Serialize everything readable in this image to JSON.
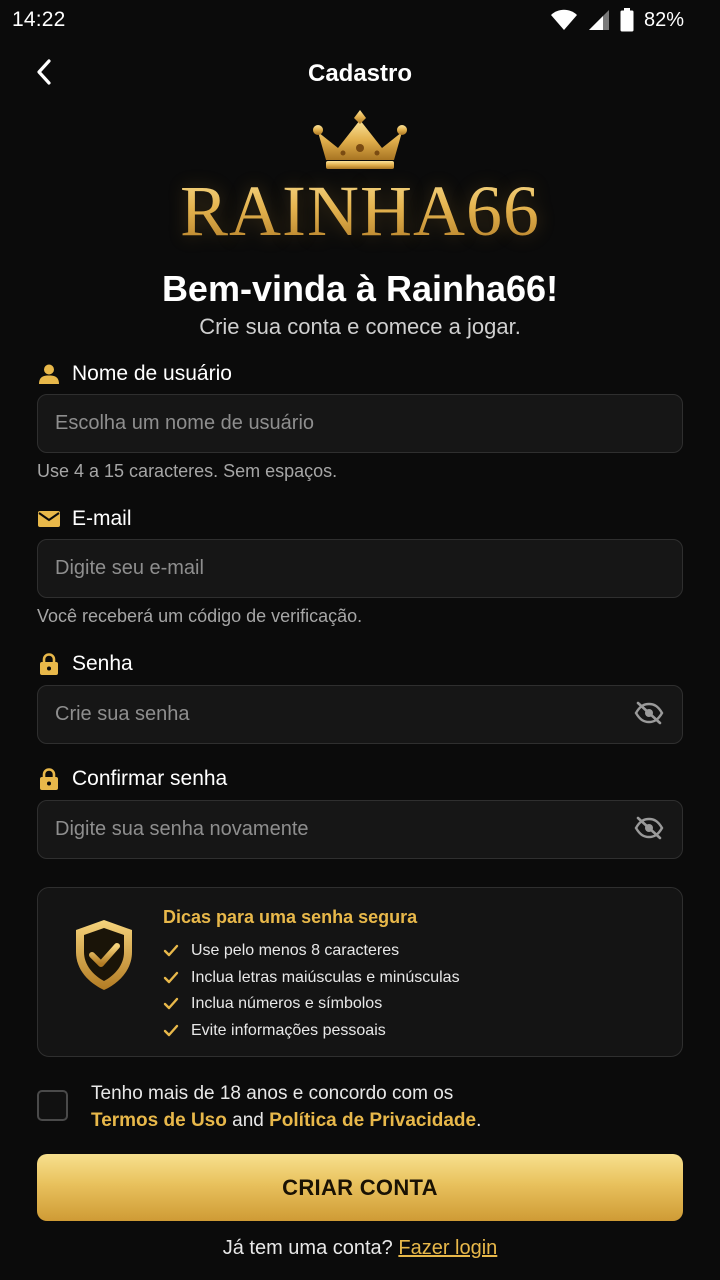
{
  "status_bar": {
    "time": "14:22",
    "battery_pct": "82%",
    "icons": [
      "wifi-icon",
      "signal-icon",
      "battery-icon"
    ]
  },
  "header": {
    "title": "Cadastro",
    "back_icon": "chevron-left-icon"
  },
  "logo": {
    "text": "RAINHA66",
    "icon": "crown-icon"
  },
  "welcome": {
    "title": "Bem-vinda à Rainha66!",
    "subtitle": "Crie sua conta e comece a jogar."
  },
  "form": {
    "username": {
      "label": "Nome de usuário",
      "icon": "user-icon",
      "placeholder": "Escolha um nome de usuário",
      "helper": "Use 4 a 15 caracteres. Sem espaços."
    },
    "email": {
      "label": "E-mail",
      "icon": "mail-icon",
      "placeholder": "Digite seu e-mail",
      "helper": "Você receberá um código de verificação."
    },
    "password": {
      "label": "Senha",
      "icon": "lock-icon",
      "placeholder": "Crie sua senha",
      "toggle_icon": "eye-off-icon"
    },
    "confirm_password": {
      "label": "Confirmar senha",
      "icon": "lock-icon",
      "placeholder": "Digite sua senha novamente",
      "toggle_icon": "eye-off-icon"
    }
  },
  "tips": {
    "icon": "shield-check-icon",
    "title": "Dicas para uma senha segura",
    "items": [
      "Use pelo menos 8 caracteres",
      "Inclua letras maiúsculas e minúsculas",
      "Inclua números e símbolos",
      "Evite informações pessoais"
    ]
  },
  "terms": {
    "checked": false,
    "line1": "Tenho mais de 18 anos e concordo com os",
    "terms_link": "Termos de Uso",
    "and": "and",
    "privacy_link": "Política de Privacidade",
    "period": "."
  },
  "actions": {
    "create_account": "CRIAR CONTA",
    "have_account": "Já tem uma conta?",
    "login_link": "Fazer login"
  },
  "colors": {
    "background": "#0b0b0b",
    "accent_gold": "#e8b84a",
    "input_bg": "#161616",
    "input_border": "#2f2f2f"
  }
}
